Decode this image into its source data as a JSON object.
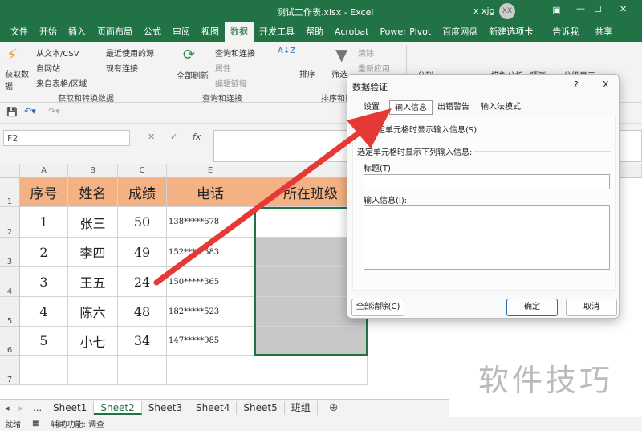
{
  "window": {
    "title": "测试工作表.xlsx - Excel",
    "user": "x xjg",
    "avatar": "XX"
  },
  "menu": [
    "文件",
    "开始",
    "插入",
    "页面布局",
    "公式",
    "审阅",
    "视图",
    "数据",
    "开发工具",
    "帮助",
    "Acrobat",
    "Power Pivot",
    "百度网盘",
    "新建选项卡",
    "告诉我",
    "共享"
  ],
  "menu_active": "数据",
  "ribbon": {
    "get": {
      "big": "获取数据",
      "items": [
        "从文本/CSV",
        "自网站",
        "来自表格/区域",
        "最近使用的源",
        "现有连接"
      ],
      "group": "获取和转换数据"
    },
    "query": {
      "big": "全部刷新",
      "items": [
        "查询和连接",
        "属性",
        "编辑链接"
      ],
      "group": "查询和连接"
    },
    "sort": {
      "sort": "排序",
      "filter": "筛选",
      "clear": "清除",
      "reapply": "重新应用",
      "group": "排序和筛选"
    },
    "tools": {
      "split": "分列",
      "whatif": "模拟分析",
      "forecast": "预测",
      "outline": "分级显示"
    }
  },
  "formula": {
    "namebox": "F2",
    "fx": "fx"
  },
  "columns": [
    "A",
    "B",
    "C",
    "E",
    ""
  ],
  "rows": [
    "1",
    "2",
    "3",
    "4",
    "5",
    "6",
    "7"
  ],
  "table": {
    "headers": [
      "序号",
      "姓名",
      "成绩",
      "电话",
      "所在班级"
    ],
    "data": [
      [
        "1",
        "张三",
        "50",
        "138*****678"
      ],
      [
        "2",
        "李四",
        "49",
        "152*****583"
      ],
      [
        "3",
        "王五",
        "24",
        "150*****365"
      ],
      [
        "4",
        "陈六",
        "48",
        "182*****523"
      ],
      [
        "5",
        "小七",
        "34",
        "147*****985"
      ]
    ]
  },
  "sheets": [
    "Sheet1",
    "Sheet2",
    "Sheet3",
    "Sheet4",
    "Sheet5",
    "班组"
  ],
  "sheet_active": "Sheet2",
  "status": {
    "ready": "就绪",
    "accessibility": "辅助功能: 调查"
  },
  "dialog": {
    "title": "数据验证",
    "help": "?",
    "close": "X",
    "tabs": [
      "设置",
      "输入信息",
      "出错警告",
      "输入法模式"
    ],
    "active_tab": "输入信息",
    "checkbox_label": "选定单元格时显示输入信息(S)",
    "checked": true,
    "section": "选定单元格时显示下列输入信息:",
    "title_label": "标题(T):",
    "title_value": "",
    "msg_label": "输入信息(I):",
    "msg_value": "",
    "clear_all": "全部清除(C)",
    "ok": "确定",
    "cancel": "取消"
  },
  "watermark": "软件技巧",
  "colors": {
    "excel_green": "#217346",
    "header_fill": "#f4b183",
    "arrow": "#e53935",
    "selection": "#c8c8c8"
  }
}
